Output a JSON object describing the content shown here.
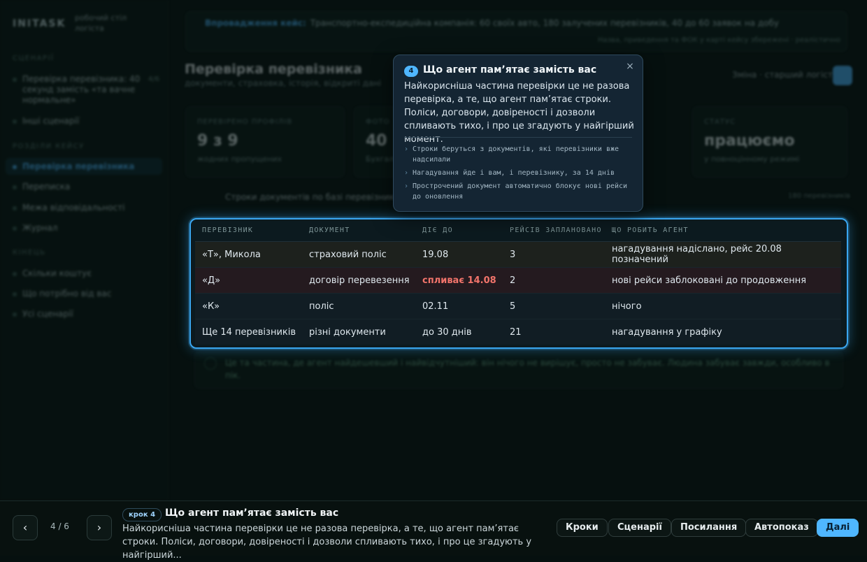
{
  "sidebar": {
    "brand": "INITASK",
    "brand_sub": "робочий стіл логіста",
    "section1": "СЦЕНАРІЇ",
    "item1": "Перевірка перевізника: 40 секунд замість «та вачне нормальне»",
    "item1_count": "4/6",
    "item2": "Інші сценарії",
    "section2": "РОЗДІЛИ КЕЙСУ",
    "items": [
      "Перевірка перевізника",
      "Переписка",
      "Межа відповідальності",
      "Журнал"
    ],
    "section3": "КІНЕЦЬ",
    "items2": [
      "Скільки коштує",
      "Що потрібно від вас",
      "Усі сценарії"
    ]
  },
  "banner": {
    "lead": "Впровадження кейс:",
    "text": "Транспортно-експедиційна компанія: 60 своїх авто, 180 залучених перевізників, 40 до 60 заявок на добу",
    "right": "Назва, приведення та ФОК у карті кейсу збережені · реалістично"
  },
  "header": {
    "title": "Перевірка перевізника",
    "subtitle": "документи, страховка, історія, відкриті дані",
    "right": "Зміна · старший логіст"
  },
  "stats": [
    {
      "label": "ПЕРЕВІРЕНО ПРОФІЛІВ",
      "value": "9 з 9",
      "sub": "жодних пропущених"
    },
    {
      "label": "ФОТО",
      "value": "40",
      "sub": "Бухгалтерія"
    },
    {
      "label": "СТАТУС",
      "value": "працюємо",
      "sub": "у повноцінному режимі"
    }
  ],
  "strip": {
    "title": "Строки документів по базі перевізників",
    "count": "180 перевізників"
  },
  "table": {
    "headers": [
      "ПЕРЕВІЗНИК",
      "ДОКУМЕНТ",
      "ДІЄ ДО",
      "РЕЙСІВ ЗАПЛАНОВАНО",
      "ЩО РОБИТЬ АГЕНТ"
    ],
    "rows": [
      [
        "«Т», Микола",
        "страховий поліс",
        "19.08",
        "3",
        "нагадування надіслано, рейс 20.08 позначений"
      ],
      [
        "«Д»",
        "договір перевезення",
        "спливає 14.08",
        "2",
        "нові рейси заблоковані до продовження"
      ],
      [
        "«К»",
        "поліс",
        "02.11",
        "5",
        "нічого"
      ],
      [
        "Ще 14 перевізників",
        "різні документи",
        "до 30 днів",
        "21",
        "нагадування у графіку"
      ]
    ]
  },
  "note": {
    "text": "Це та частина, де агент найдешевший і найвідчутніший: він нічого не вирішує, просто не забуває. Людина забуває завжди, особливо в пік."
  },
  "popover": {
    "badge": "4",
    "title": "Що агент пам’ятає замість вас",
    "body": "Найкорисніша частина перевірки це не разова перевірка, а те, що агент пам’ятає строки. Поліси, договори, довіреності і дозволи спливають тихо, і про це згадують у найгірший момент.",
    "bullets": [
      "Строки беруться з документів, які перевізники вже надсилали",
      "Нагадування йде і вам, і перевізнику, за 14 днів",
      "Прострочений документ автоматично блокує нові рейси до оновлення"
    ],
    "close": "×"
  },
  "bottom": {
    "prev": "‹",
    "next": "›",
    "counter": "4 / 6",
    "step_badge": "крок 4",
    "step_title": "Що агент пам’ятає замість вас",
    "step_desc": "Найкорисніша частина перевірки це не разова перевірка, а те, що агент пам’ятає строки. Поліси, договори, довіреності і дозволи спливають тихо, і про це згадують у найгірший...",
    "buttons": [
      "Кроки",
      "Сценарії",
      "Посилання",
      "Автопоказ",
      "Далі"
    ]
  },
  "colors": {
    "accent": "#4fb6ff",
    "danger": "#f2746b",
    "background": "#06100f"
  }
}
